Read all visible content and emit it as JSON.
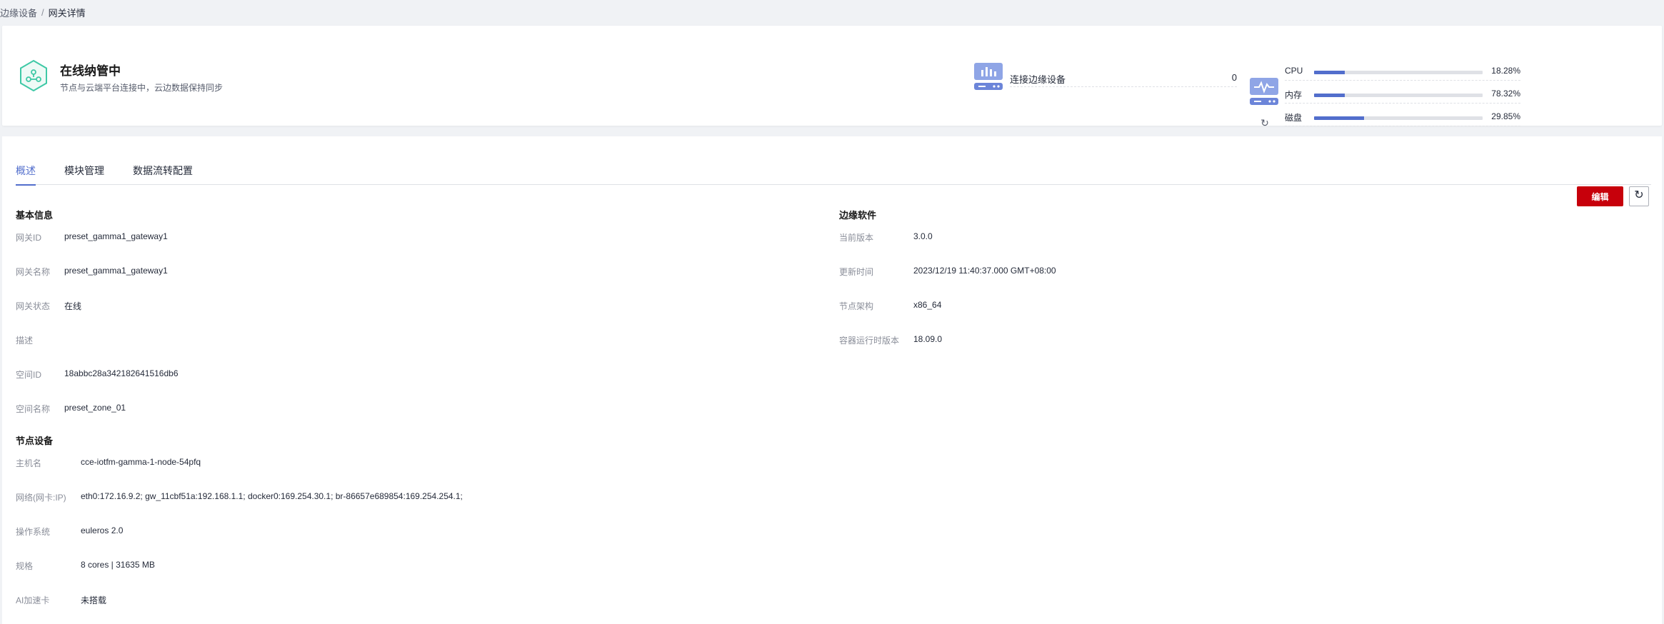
{
  "breadcrumb": {
    "parent": "边缘设备",
    "separator": "/",
    "current": "网关详情"
  },
  "status": {
    "title": "在线纳管中",
    "description": "节点与云端平台连接中，云边数据保持同步"
  },
  "devices": {
    "label": "连接边缘设备",
    "value": "0"
  },
  "metrics": [
    {
      "label": "CPU",
      "value": "18.28%",
      "percent": 18.28
    },
    {
      "label": "内存",
      "value": "78.32%",
      "percent": 18.28
    },
    {
      "label": "磁盘",
      "value": "29.85%",
      "percent": 29.85
    }
  ],
  "tabs": [
    {
      "label": "概述",
      "active": true
    },
    {
      "label": "模块管理",
      "active": false
    },
    {
      "label": "数据流转配置",
      "active": false
    }
  ],
  "actions": {
    "edit_label": "编辑"
  },
  "basic_info": {
    "title": "基本信息",
    "fields": [
      {
        "label": "网关ID",
        "value": "preset_gamma1_gateway1"
      },
      {
        "label": "网关名称",
        "value": "preset_gamma1_gateway1"
      },
      {
        "label": "网关状态",
        "value": "在线"
      },
      {
        "label": "描述",
        "value": ""
      },
      {
        "label": "空间ID",
        "value": "18abbc28a342182641516db6"
      },
      {
        "label": "空间名称",
        "value": "preset_zone_01"
      }
    ]
  },
  "edge_software": {
    "title": "边缘软件",
    "fields": [
      {
        "label": "当前版本",
        "value": "3.0.0"
      },
      {
        "label": "更新时间",
        "value": "2023/12/19 11:40:37.000 GMT+08:00"
      },
      {
        "label": "节点架构",
        "value": "x86_64"
      },
      {
        "label": "容器运行时版本",
        "value": "18.09.0"
      }
    ]
  },
  "node_device": {
    "title": "节点设备",
    "fields": [
      {
        "label": "主机名",
        "value": "cce-iotfm-gamma-1-node-54pfq"
      },
      {
        "label": "网络(网卡:IP)",
        "value": "eth0:172.16.9.2; gw_11cbf51a:192.168.1.1; docker0:169.254.30.1; br-86657e689854:169.254.254.1;"
      },
      {
        "label": "操作系统",
        "value": "euleros 2.0"
      },
      {
        "label": "规格",
        "value": "8 cores | 31635 MB"
      },
      {
        "label": "AI加速卡",
        "value": "未搭载"
      }
    ]
  },
  "colors": {
    "accent": "#526ecc",
    "status_green": "#3fc9a6",
    "primary_button": "#c7000b"
  }
}
